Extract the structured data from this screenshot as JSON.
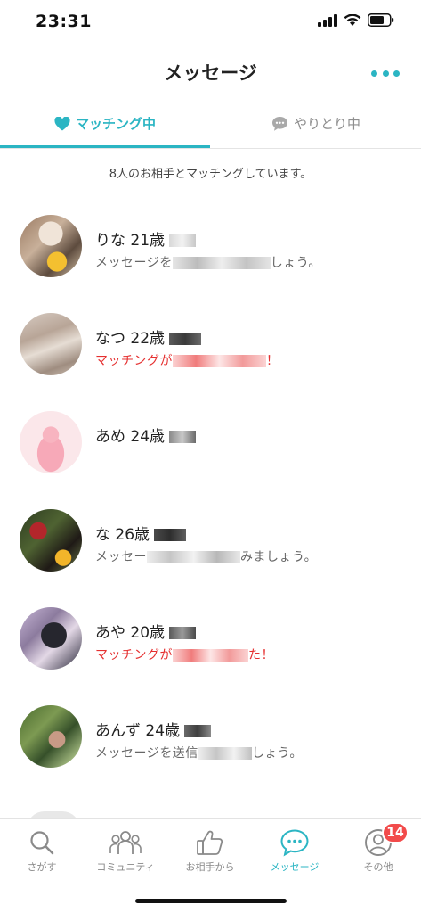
{
  "status_bar": {
    "time": "23:31"
  },
  "header": {
    "title": "メッセージ"
  },
  "tabs": [
    {
      "label": "マッチング中",
      "icon": "heart-icon",
      "active": true
    },
    {
      "label": "やりとり中",
      "icon": "speech-bubble-icon",
      "active": false
    }
  ],
  "summary": "8人のお相手とマッチングしています。",
  "matches": [
    {
      "name": "りな 21歳",
      "message_start": "メッセージを",
      "message_end": "しょう。",
      "highlight": false
    },
    {
      "name": "なつ 22歳",
      "message_start": "マッチングが",
      "message_end": "！",
      "highlight": true
    },
    {
      "name": "あめ 24歳",
      "message_start": "",
      "message_end": "",
      "highlight": false
    },
    {
      "name": "な 26歳",
      "message_start": "メッセー",
      "message_end": "みましょう。",
      "highlight": false
    },
    {
      "name": "あや 20歳",
      "message_start": "マッチングが",
      "message_end": "た！",
      "highlight": true
    },
    {
      "name": "あんず 24歳",
      "message_start": "メッセージを送信",
      "message_end": "しょう。",
      "highlight": false
    }
  ],
  "nav": {
    "items": [
      {
        "label": "さがす",
        "icon": "search-icon",
        "active": false
      },
      {
        "label": "コミュニティ",
        "icon": "community-icon",
        "active": false
      },
      {
        "label": "お相手から",
        "icon": "thumbs-up-icon",
        "active": false
      },
      {
        "label": "メッセージ",
        "icon": "message-icon",
        "active": true
      },
      {
        "label": "その他",
        "icon": "profile-icon",
        "active": false,
        "badge": "14"
      }
    ]
  },
  "colors": {
    "accent": "#2bb5c3",
    "alert": "#e53030",
    "badge": "#f24b4b"
  }
}
